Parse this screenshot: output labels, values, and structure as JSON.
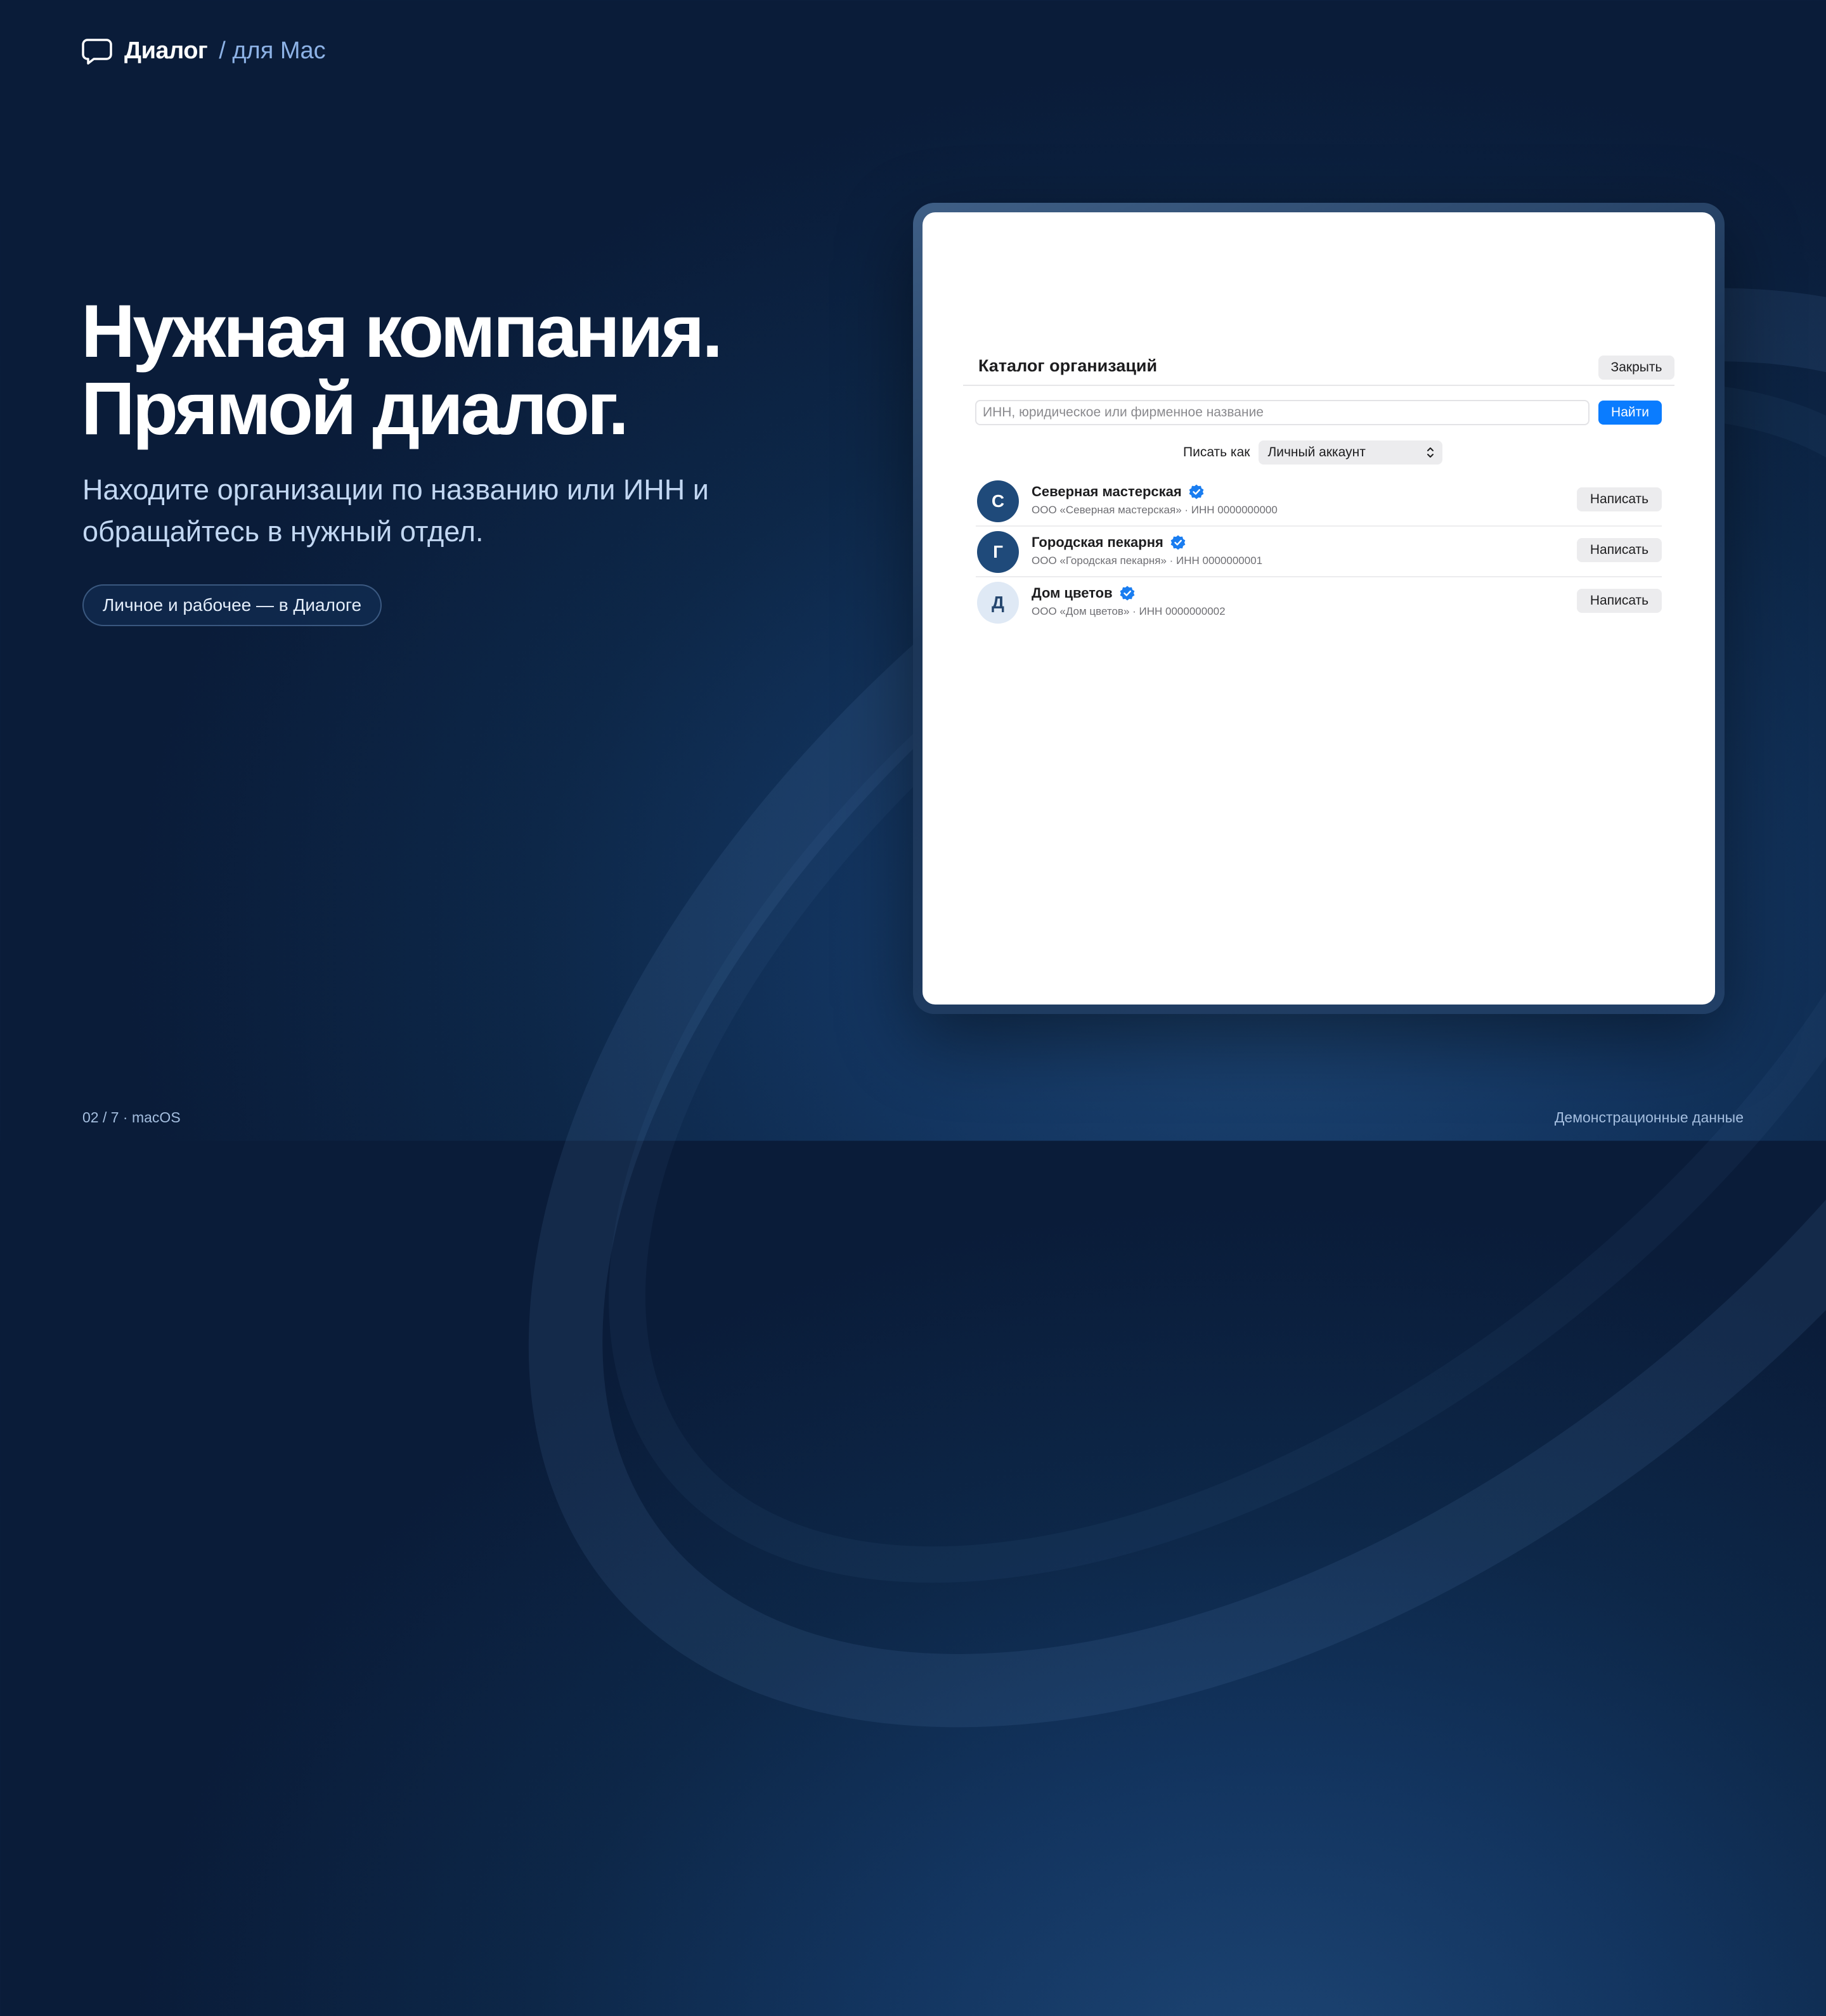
{
  "header": {
    "brand_name": "Диалог",
    "brand_sub": "/ для Mac"
  },
  "hero": {
    "title_line1": "Нужная компания.",
    "title_line2": "Прямой диалог.",
    "subtitle_line1": "Находите организации по названию или ИНН и",
    "subtitle_line2": "обращайтесь в нужный отдел.",
    "pill_label": "Личное и рабочее — в Диалоге"
  },
  "footer": {
    "left": "02 / 7 · macOS",
    "right": "Демонстрационные данные"
  },
  "window": {
    "title": "Каталог организаций",
    "close_label": "Закрыть",
    "search": {
      "placeholder": "ИНН, юридическое или фирменное название",
      "value": "",
      "button_label": "Найти"
    },
    "write_as": {
      "label": "Писать как",
      "selected": "Личный аккаунт"
    },
    "organizations": [
      {
        "initial": "С",
        "name": "Северная мастерская",
        "meta": "ООО «Северная мастерская» · ИНН 0000000000",
        "verified": true,
        "action_label": "Написать",
        "avatar_style": "dark"
      },
      {
        "initial": "Г",
        "name": "Городская пекарня",
        "meta": "ООО «Городская пекарня» · ИНН 0000000001",
        "verified": true,
        "action_label": "Написать",
        "avatar_style": "dark"
      },
      {
        "initial": "Д",
        "name": "Дом цветов",
        "meta": "ООО «Дом цветов» · ИНН 0000000002",
        "verified": true,
        "action_label": "Написать",
        "avatar_style": "light"
      }
    ]
  },
  "colors": {
    "accent": "#0a7cff",
    "verified": "#1a7df0",
    "avatar_dark": "#1f4a7a",
    "avatar_light": "#dfe9f5"
  },
  "icons": {
    "brand": "chat-bubble-icon",
    "verified": "verified-badge-icon",
    "select": "chevron-up-down-icon"
  }
}
